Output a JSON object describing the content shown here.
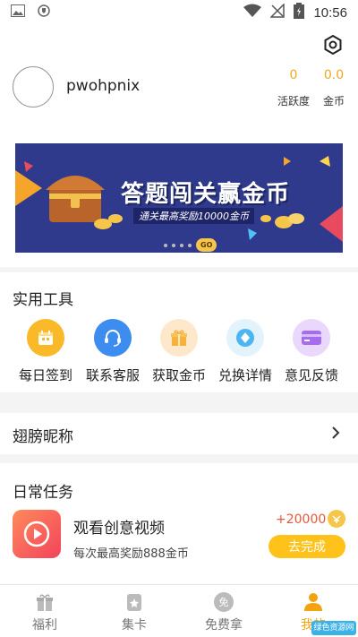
{
  "status_bar": {
    "time": "10:56"
  },
  "profile": {
    "username": "pwohpnix",
    "stats": [
      {
        "value": "0",
        "label": "活跃度"
      },
      {
        "value": "0.0",
        "label": "金币"
      }
    ]
  },
  "banner": {
    "title": "答题闯关赢金币",
    "subtitle": "通关最高奖励10000金币",
    "badge": "GO"
  },
  "tools": {
    "title": "实用工具",
    "items": [
      {
        "label": "每日签到",
        "icon": "calendar-icon",
        "color": "#f9b928"
      },
      {
        "label": "联系客服",
        "icon": "headset-icon",
        "color": "#3d8cf0"
      },
      {
        "label": "获取金币",
        "icon": "gift-icon",
        "color": "#fde8cc"
      },
      {
        "label": "兑换详情",
        "icon": "diamond-icon",
        "color": "#e2f3fc"
      },
      {
        "label": "意见反馈",
        "icon": "card-icon",
        "color": "#e9d8fb"
      }
    ]
  },
  "nickname": {
    "label": "翅膀昵称"
  },
  "tasks": {
    "title": "日常任务",
    "item": {
      "title": "观看创意视频",
      "desc": "每次最高奖励888金币",
      "reward": "+20000",
      "button": "去完成"
    }
  },
  "tabbar": {
    "tabs": [
      {
        "label": "福利",
        "icon": "gift-icon"
      },
      {
        "label": "集卡",
        "icon": "card-star-icon"
      },
      {
        "label": "免费拿",
        "icon": "free-icon",
        "icon_text": "免"
      },
      {
        "label": "我的",
        "icon": "person-icon"
      }
    ],
    "active_index": 3
  },
  "watermark": "绿色资源网"
}
